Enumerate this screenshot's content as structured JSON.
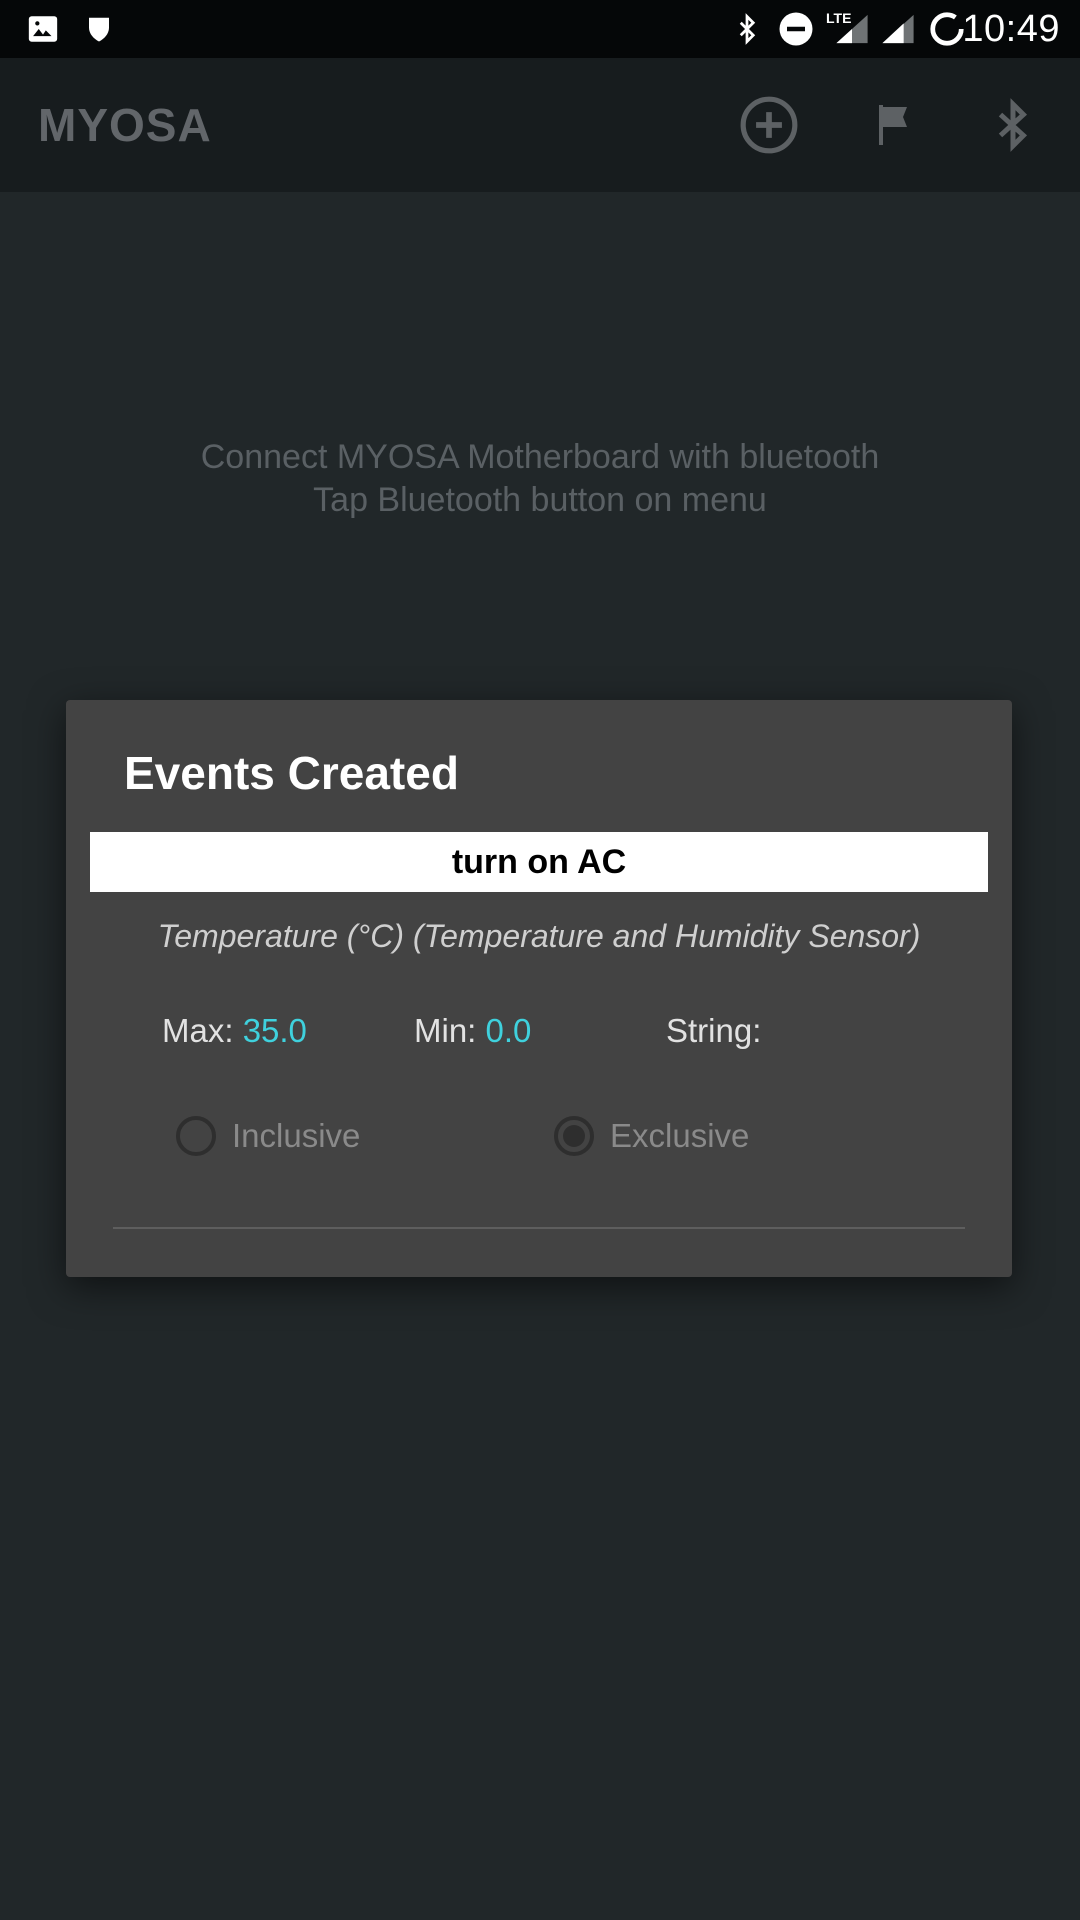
{
  "status_bar": {
    "time": "10:49",
    "network_label": "LTE",
    "left_icons": [
      "image-icon",
      "shield-icon"
    ],
    "right_icons": [
      "bluetooth-icon",
      "do-not-disturb-icon",
      "signal-icon",
      "signal-icon",
      "sync-icon"
    ]
  },
  "app_bar": {
    "title": "MYOSA",
    "actions": [
      "add-circle-icon",
      "flag-icon",
      "bluetooth-icon"
    ]
  },
  "main": {
    "message_line1": "Connect MYOSA Motherboard with bluetooth",
    "message_line2": "Tap Bluetooth button on menu"
  },
  "dialog": {
    "title": "Events Created",
    "event_name": "turn on AC",
    "sensor": "Temperature (°C) (Temperature and Humidity Sensor)",
    "max_label": "Max:",
    "max_value": "35.0",
    "min_label": "Min:",
    "min_value": "0.0",
    "string_label": "String:",
    "string_value": "",
    "options": [
      {
        "label": "Inclusive",
        "selected": false
      },
      {
        "label": "Exclusive",
        "selected": true
      }
    ]
  },
  "colors": {
    "background": "#212729",
    "app_bar": "#171c1e",
    "dialog": "#434343",
    "accent_value": "#3fd1dd"
  }
}
